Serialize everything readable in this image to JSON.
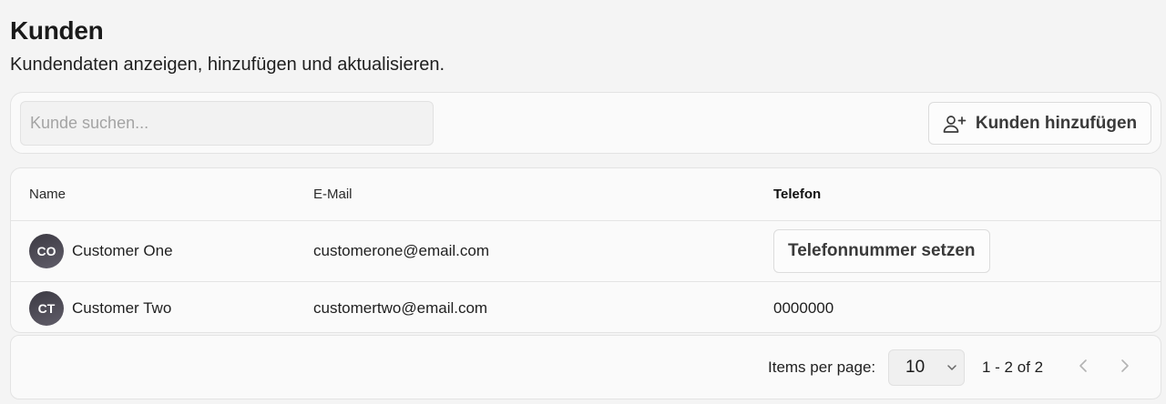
{
  "header": {
    "title": "Kunden",
    "subtitle": "Kundendaten anzeigen, hinzufügen und aktualisieren."
  },
  "toolbar": {
    "search_placeholder": "Kunde suchen...",
    "search_value": "",
    "add_label": "Kunden hinzufügen",
    "add_icon": "user-plus-icon"
  },
  "table": {
    "columns": [
      "Name",
      "E-Mail",
      "Telefon"
    ],
    "rows": [
      {
        "initials": "CO",
        "name": "Customer One",
        "email": "customerone@email.com",
        "phone": "",
        "phone_action": "Telefonnummer setzen"
      },
      {
        "initials": "CT",
        "name": "Customer Two",
        "email": "customertwo@email.com",
        "phone": "0000000"
      }
    ]
  },
  "pagination": {
    "items_per_page_label": "Items per page:",
    "page_size": "10",
    "range": "1 - 2 of 2",
    "prev_icon": "chevron-left-icon",
    "next_icon": "chevron-right-icon"
  },
  "colors": {
    "background": "#f4f4f4",
    "card": "#fafafa",
    "border": "#e3e3e3",
    "avatar": "#4b4854"
  }
}
